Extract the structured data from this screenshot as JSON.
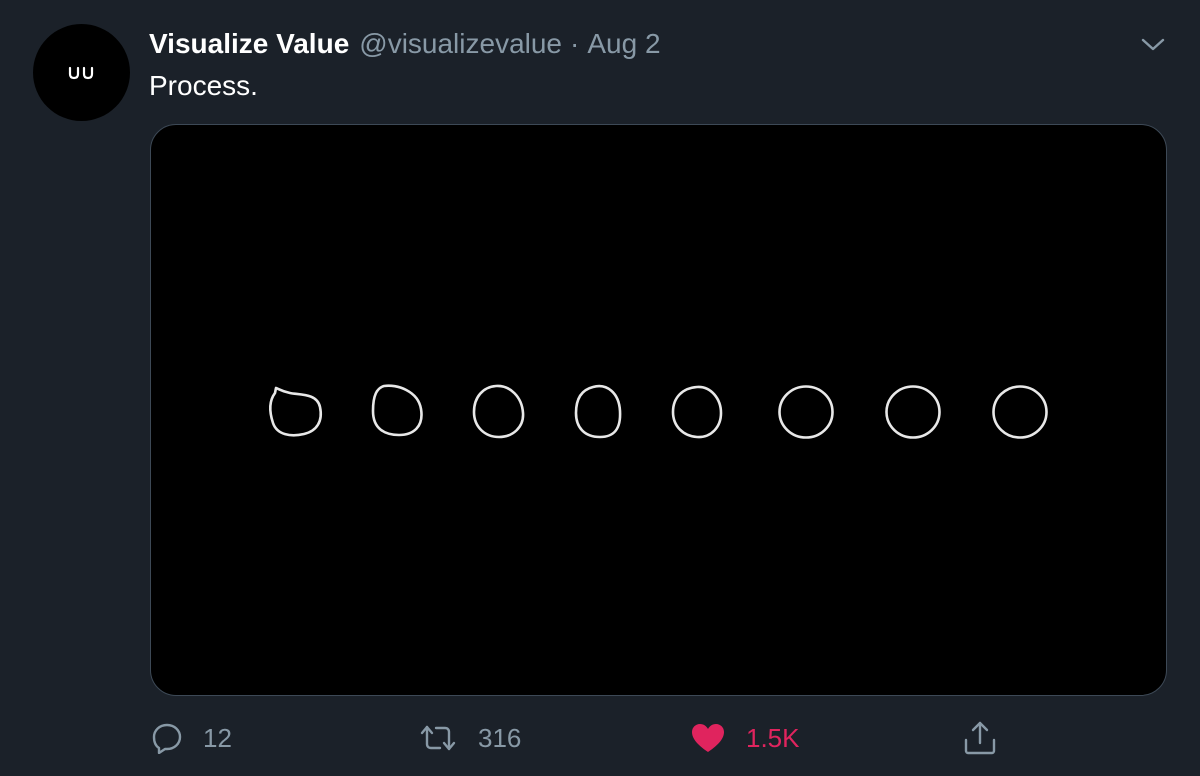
{
  "tweet": {
    "author": {
      "display_name": "Visualize Value",
      "handle": "@visualizevalue",
      "avatar_icon": "visualize-value-logo"
    },
    "separator": "·",
    "date": "Aug 2",
    "text": "Process.",
    "menu_icon": "chevron-down-icon",
    "media": {
      "kind": "image",
      "description_icon": "eight-hand-drawn-circles"
    },
    "actions": {
      "reply": {
        "icon": "reply-icon",
        "count": "12"
      },
      "retweet": {
        "icon": "retweet-icon",
        "count": "316"
      },
      "like": {
        "icon": "heart-icon",
        "count": "1.5K",
        "liked": true
      },
      "share": {
        "icon": "share-icon"
      }
    }
  },
  "colors": {
    "background": "#1b2129",
    "text_primary": "#ffffff",
    "text_secondary": "#8899a6",
    "like": "#e0245e",
    "media_border": "#3d4956"
  }
}
